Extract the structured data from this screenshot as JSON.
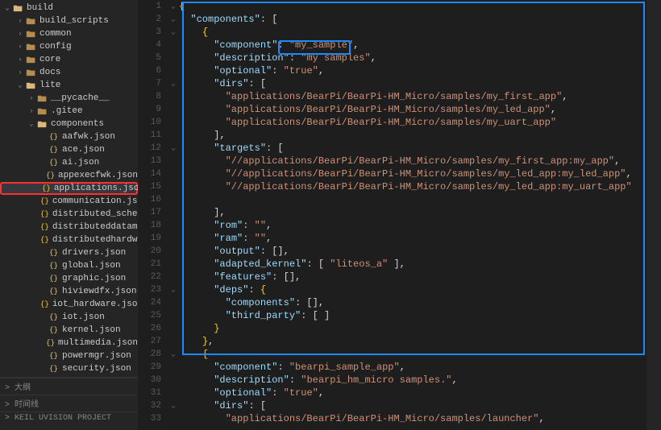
{
  "sidebar": {
    "items": [
      {
        "label": "build",
        "kind": "folder-open",
        "chev": "down",
        "indent": 0
      },
      {
        "label": "build_scripts",
        "kind": "folder",
        "chev": "right",
        "indent": 1
      },
      {
        "label": "common",
        "kind": "folder",
        "chev": "right",
        "indent": 1
      },
      {
        "label": "config",
        "kind": "folder",
        "chev": "right",
        "indent": 1
      },
      {
        "label": "core",
        "kind": "folder",
        "chev": "right",
        "indent": 1
      },
      {
        "label": "docs",
        "kind": "folder",
        "chev": "right",
        "indent": 1
      },
      {
        "label": "lite",
        "kind": "folder-open",
        "chev": "down",
        "indent": 1
      },
      {
        "label": "__pycache__",
        "kind": "folder",
        "chev": "right",
        "indent": 2
      },
      {
        "label": ".gitee",
        "kind": "folder",
        "chev": "right",
        "indent": 2
      },
      {
        "label": "components",
        "kind": "folder-open",
        "chev": "down",
        "indent": 2
      },
      {
        "label": "aafwk.json",
        "kind": "json",
        "indent": 3
      },
      {
        "label": "ace.json",
        "kind": "json",
        "indent": 3
      },
      {
        "label": "ai.json",
        "kind": "json",
        "indent": 3
      },
      {
        "label": "appexecfwk.json",
        "kind": "json",
        "indent": 3
      },
      {
        "label": "applications.json",
        "kind": "json",
        "indent": 3,
        "selected": true,
        "redbox": true
      },
      {
        "label": "communication.json",
        "kind": "json",
        "indent": 3
      },
      {
        "label": "distributed_schedul...",
        "kind": "json",
        "indent": 3
      },
      {
        "label": "distributeddatamgr....",
        "kind": "json",
        "indent": 3
      },
      {
        "label": "distributedhardwar...",
        "kind": "json",
        "indent": 3
      },
      {
        "label": "drivers.json",
        "kind": "json",
        "indent": 3
      },
      {
        "label": "global.json",
        "kind": "json",
        "indent": 3
      },
      {
        "label": "graphic.json",
        "kind": "json",
        "indent": 3
      },
      {
        "label": "hiviewdfx.json",
        "kind": "json",
        "indent": 3
      },
      {
        "label": "iot_hardware.json",
        "kind": "json",
        "indent": 3
      },
      {
        "label": "iot.json",
        "kind": "json",
        "indent": 3
      },
      {
        "label": "kernel.json",
        "kind": "json",
        "indent": 3
      },
      {
        "label": "multimedia.json",
        "kind": "json",
        "indent": 3
      },
      {
        "label": "powermgr.json",
        "kind": "json",
        "indent": 3
      },
      {
        "label": "security.json",
        "kind": "json",
        "indent": 3
      }
    ]
  },
  "bottom": {
    "outline": "大纲",
    "timeline": "时间线",
    "project": "KEIL UVISION PROJECT"
  },
  "editor": {
    "lines": [
      {
        "num": 1,
        "fold": "v",
        "tokens": [
          {
            "t": "{",
            "c": "b"
          }
        ]
      },
      {
        "num": 2,
        "fold": "v",
        "tokens": [
          {
            "t": "  ",
            "c": "p"
          },
          {
            "t": "\"components\"",
            "c": "k"
          },
          {
            "t": ": [",
            "c": "p"
          }
        ]
      },
      {
        "num": 3,
        "fold": "v",
        "tokens": [
          {
            "t": "    ",
            "c": "p"
          },
          {
            "t": "{",
            "c": "b"
          }
        ]
      },
      {
        "num": 4,
        "fold": "",
        "tokens": [
          {
            "t": "      ",
            "c": "p"
          },
          {
            "t": "\"component\"",
            "c": "k"
          },
          {
            "t": ": ",
            "c": "p"
          },
          {
            "t": "\"my_sample\"",
            "c": "s"
          },
          {
            "t": ",",
            "c": "p"
          }
        ]
      },
      {
        "num": 5,
        "fold": "",
        "tokens": [
          {
            "t": "      ",
            "c": "p"
          },
          {
            "t": "\"description\"",
            "c": "k"
          },
          {
            "t": ": ",
            "c": "p"
          },
          {
            "t": "\"my samples\"",
            "c": "s"
          },
          {
            "t": ",",
            "c": "p"
          }
        ]
      },
      {
        "num": 6,
        "fold": "",
        "tokens": [
          {
            "t": "      ",
            "c": "p"
          },
          {
            "t": "\"optional\"",
            "c": "k"
          },
          {
            "t": ": ",
            "c": "p"
          },
          {
            "t": "\"true\"",
            "c": "s"
          },
          {
            "t": ",",
            "c": "p"
          }
        ]
      },
      {
        "num": 7,
        "fold": "v",
        "tokens": [
          {
            "t": "      ",
            "c": "p"
          },
          {
            "t": "\"dirs\"",
            "c": "k"
          },
          {
            "t": ": [",
            "c": "p"
          }
        ]
      },
      {
        "num": 8,
        "fold": "",
        "tokens": [
          {
            "t": "        ",
            "c": "p"
          },
          {
            "t": "\"applications/BearPi/BearPi-HM_Micro/samples/my_first_app\"",
            "c": "s"
          },
          {
            "t": ",",
            "c": "p"
          }
        ]
      },
      {
        "num": 9,
        "fold": "",
        "tokens": [
          {
            "t": "        ",
            "c": "p"
          },
          {
            "t": "\"applications/BearPi/BearPi-HM_Micro/samples/my_led_app\"",
            "c": "s"
          },
          {
            "t": ",",
            "c": "p"
          }
        ]
      },
      {
        "num": 10,
        "fold": "",
        "tokens": [
          {
            "t": "        ",
            "c": "p"
          },
          {
            "t": "\"applications/BearPi/BearPi-HM_Micro/samples/my_uart_app\"",
            "c": "s"
          }
        ]
      },
      {
        "num": 11,
        "fold": "",
        "tokens": [
          {
            "t": "      ",
            "c": "p"
          },
          {
            "t": "],",
            "c": "p"
          }
        ]
      },
      {
        "num": 12,
        "fold": "v",
        "tokens": [
          {
            "t": "      ",
            "c": "p"
          },
          {
            "t": "\"targets\"",
            "c": "k"
          },
          {
            "t": ": [",
            "c": "p"
          }
        ]
      },
      {
        "num": 13,
        "fold": "",
        "tokens": [
          {
            "t": "        ",
            "c": "p"
          },
          {
            "t": "\"//applications/BearPi/BearPi-HM_Micro/samples/my_first_app:my_app\"",
            "c": "s"
          },
          {
            "t": ",",
            "c": "p"
          }
        ]
      },
      {
        "num": 14,
        "fold": "",
        "tokens": [
          {
            "t": "        ",
            "c": "p"
          },
          {
            "t": "\"//applications/BearPi/BearPi-HM_Micro/samples/my_led_app:my_led_app\"",
            "c": "s"
          },
          {
            "t": ",",
            "c": "p"
          }
        ]
      },
      {
        "num": 15,
        "fold": "",
        "tokens": [
          {
            "t": "        ",
            "c": "p"
          },
          {
            "t": "\"//applications/BearPi/BearPi-HM_Micro/samples/my_led_app:my_uart_app\"",
            "c": "s"
          }
        ]
      },
      {
        "num": 16,
        "fold": "",
        "tokens": [
          {
            "t": "",
            "c": "p"
          }
        ]
      },
      {
        "num": 17,
        "fold": "",
        "tokens": [
          {
            "t": "      ",
            "c": "p"
          },
          {
            "t": "],",
            "c": "p"
          }
        ]
      },
      {
        "num": 18,
        "fold": "",
        "tokens": [
          {
            "t": "      ",
            "c": "p"
          },
          {
            "t": "\"rom\"",
            "c": "k"
          },
          {
            "t": ": ",
            "c": "p"
          },
          {
            "t": "\"\"",
            "c": "s"
          },
          {
            "t": ",",
            "c": "p"
          }
        ]
      },
      {
        "num": 19,
        "fold": "",
        "tokens": [
          {
            "t": "      ",
            "c": "p"
          },
          {
            "t": "\"ram\"",
            "c": "k"
          },
          {
            "t": ": ",
            "c": "p"
          },
          {
            "t": "\"\"",
            "c": "s"
          },
          {
            "t": ",",
            "c": "p"
          }
        ]
      },
      {
        "num": 20,
        "fold": "",
        "tokens": [
          {
            "t": "      ",
            "c": "p"
          },
          {
            "t": "\"output\"",
            "c": "k"
          },
          {
            "t": ": [],",
            "c": "p"
          }
        ]
      },
      {
        "num": 21,
        "fold": "",
        "tokens": [
          {
            "t": "      ",
            "c": "p"
          },
          {
            "t": "\"adapted_kernel\"",
            "c": "k"
          },
          {
            "t": ": [ ",
            "c": "p"
          },
          {
            "t": "\"liteos_a\"",
            "c": "s"
          },
          {
            "t": " ],",
            "c": "p"
          }
        ]
      },
      {
        "num": 22,
        "fold": "",
        "tokens": [
          {
            "t": "      ",
            "c": "p"
          },
          {
            "t": "\"features\"",
            "c": "k"
          },
          {
            "t": ": [],",
            "c": "p"
          }
        ]
      },
      {
        "num": 23,
        "fold": "v",
        "tokens": [
          {
            "t": "      ",
            "c": "p"
          },
          {
            "t": "\"deps\"",
            "c": "k"
          },
          {
            "t": ": ",
            "c": "p"
          },
          {
            "t": "{",
            "c": "b"
          }
        ]
      },
      {
        "num": 24,
        "fold": "",
        "tokens": [
          {
            "t": "        ",
            "c": "p"
          },
          {
            "t": "\"components\"",
            "c": "k"
          },
          {
            "t": ": [],",
            "c": "p"
          }
        ]
      },
      {
        "num": 25,
        "fold": "",
        "tokens": [
          {
            "t": "        ",
            "c": "p"
          },
          {
            "t": "\"third_party\"",
            "c": "k"
          },
          {
            "t": ": [ ]",
            "c": "p"
          }
        ]
      },
      {
        "num": 26,
        "fold": "",
        "tokens": [
          {
            "t": "      ",
            "c": "p"
          },
          {
            "t": "}",
            "c": "b"
          }
        ]
      },
      {
        "num": 27,
        "fold": "",
        "tokens": [
          {
            "t": "    ",
            "c": "p"
          },
          {
            "t": "}",
            "c": "b"
          },
          {
            "t": ",",
            "c": "p"
          }
        ]
      },
      {
        "num": 28,
        "fold": "v",
        "tokens": [
          {
            "t": "    ",
            "c": "p"
          },
          {
            "t": "{",
            "c": "b"
          }
        ]
      },
      {
        "num": 29,
        "fold": "",
        "tokens": [
          {
            "t": "      ",
            "c": "p"
          },
          {
            "t": "\"component\"",
            "c": "k"
          },
          {
            "t": ": ",
            "c": "p"
          },
          {
            "t": "\"bearpi_sample_app\"",
            "c": "s"
          },
          {
            "t": ",",
            "c": "p"
          }
        ]
      },
      {
        "num": 30,
        "fold": "",
        "tokens": [
          {
            "t": "      ",
            "c": "p"
          },
          {
            "t": "\"description\"",
            "c": "k"
          },
          {
            "t": ": ",
            "c": "p"
          },
          {
            "t": "\"bearpi_hm_micro samples.\"",
            "c": "s"
          },
          {
            "t": ",",
            "c": "p"
          }
        ]
      },
      {
        "num": 31,
        "fold": "",
        "tokens": [
          {
            "t": "      ",
            "c": "p"
          },
          {
            "t": "\"optional\"",
            "c": "k"
          },
          {
            "t": ": ",
            "c": "p"
          },
          {
            "t": "\"true\"",
            "c": "s"
          },
          {
            "t": ",",
            "c": "p"
          }
        ]
      },
      {
        "num": 32,
        "fold": "v",
        "tokens": [
          {
            "t": "      ",
            "c": "p"
          },
          {
            "t": "\"dirs\"",
            "c": "k"
          },
          {
            "t": ": [",
            "c": "p"
          }
        ]
      },
      {
        "num": 33,
        "fold": "",
        "tokens": [
          {
            "t": "        ",
            "c": "p"
          },
          {
            "t": "\"applications/BearPi/BearPi-HM_Micro/samples/launcher\"",
            "c": "s"
          },
          {
            "t": ",",
            "c": "p"
          }
        ]
      }
    ]
  }
}
